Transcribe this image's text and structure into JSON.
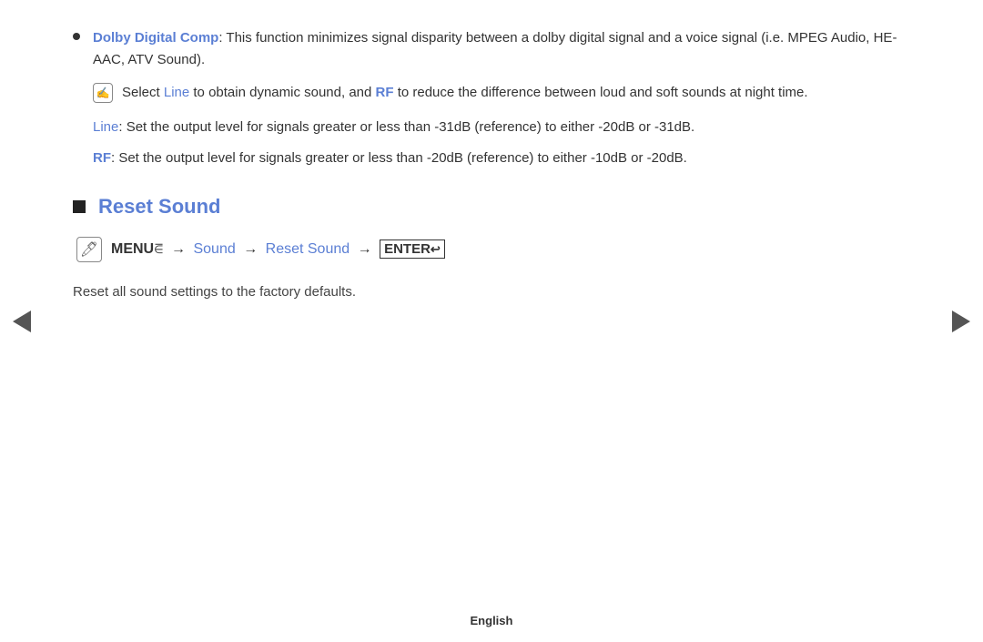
{
  "navigation": {
    "left_arrow_label": "previous page",
    "right_arrow_label": "next page"
  },
  "content": {
    "bullet_items": [
      {
        "link_text": "Dolby Digital Comp",
        "text": ": This function minimizes signal disparity between a dolby digital signal and a voice signal (i.e. MPEG Audio, HE-AAC, ATV Sound)."
      }
    ],
    "note": {
      "prefix": "Select ",
      "link1": "Line",
      "middle": " to obtain dynamic sound, and ",
      "link2": "RF",
      "suffix": " to reduce the difference between loud and soft sounds at night time."
    },
    "sub_items": [
      {
        "link_text": "Line",
        "text": ": Set the output level for signals greater or less than -31dB (reference) to either -20dB or -31dB."
      },
      {
        "link_text": "RF",
        "text": ": Set the output level for signals greater or less than -20dB (reference) to either -10dB or -20dB."
      }
    ],
    "section": {
      "title": "Reset Sound",
      "menu_path": {
        "menu_label": "MENU",
        "arrow1": "→",
        "path1": "Sound",
        "arrow2": "→",
        "path2": "Reset Sound",
        "arrow3": "→",
        "enter_label": "ENTER"
      },
      "description": "Reset all sound settings to the factory defaults."
    }
  },
  "footer": {
    "language": "English"
  }
}
